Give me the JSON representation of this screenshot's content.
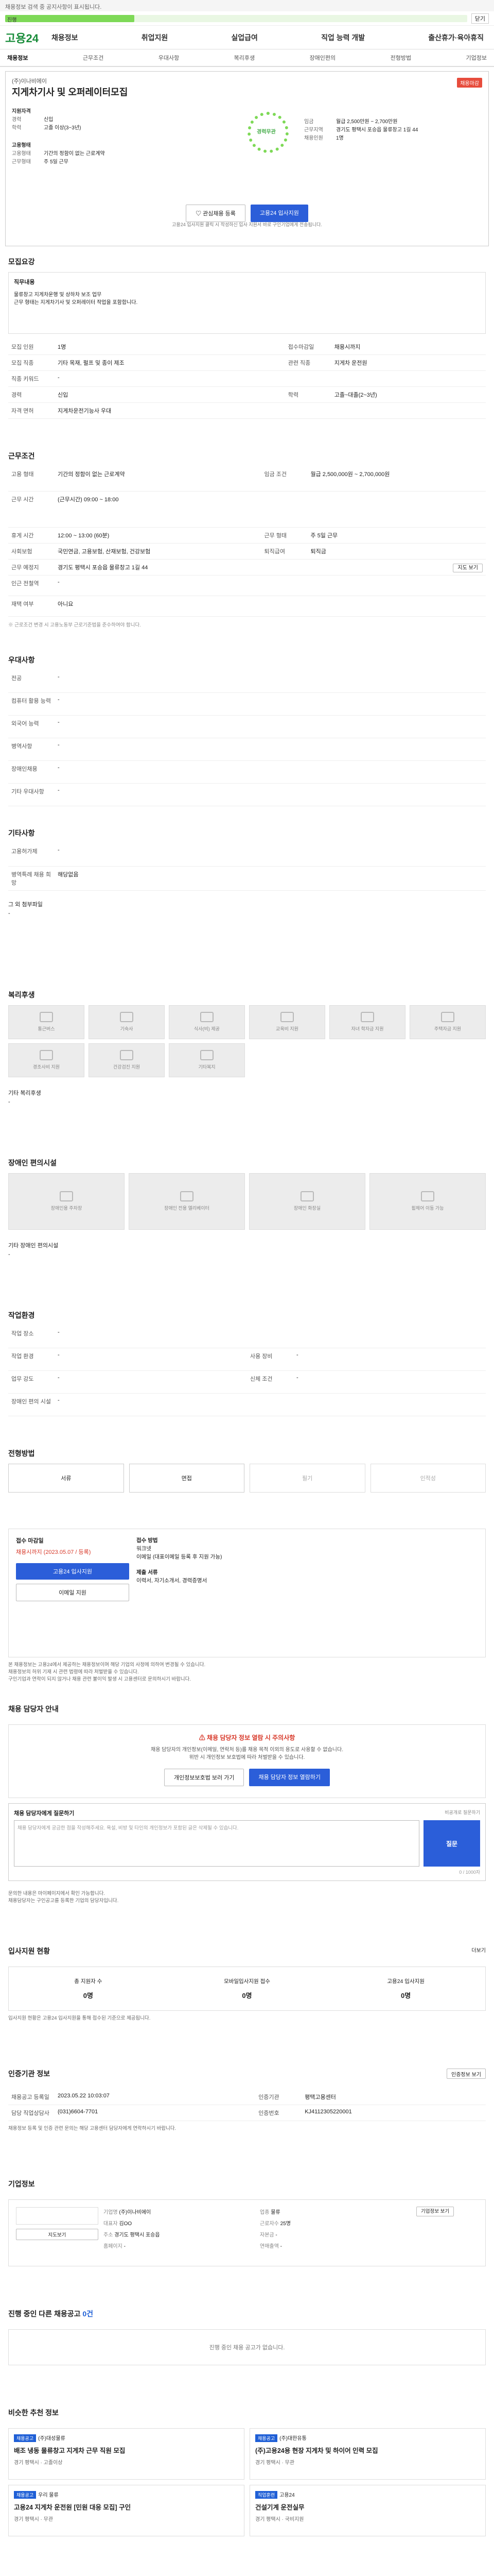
{
  "notice": "채용정보 검색 중 공지사항이 표시됩니다.",
  "progress": {
    "label": "진행",
    "fraction": 0.28,
    "button": "닫기"
  },
  "header": {
    "logo": "고용24",
    "gnb": [
      "채용정보",
      "취업지원",
      "실업급여",
      "직업 능력 개발",
      "출산휴가·육아휴직"
    ]
  },
  "subnav": [
    "채용정보",
    "근무조건",
    "우대사항",
    "복리후생",
    "장애인편의",
    "전형방법",
    "기업정보"
  ],
  "job": {
    "company": "(주)이나비에이",
    "title": "지게차기사 및 오퍼레이터모집",
    "tag": "채용마감",
    "rows": [
      {
        "k": "지원자격",
        "v": ""
      },
      {
        "k": "경력",
        "v": "신입"
      },
      {
        "k": "학력",
        "v": "고졸 이상(3~3년)"
      },
      {
        "k": "고용형태",
        "v": ""
      },
      {
        "k": "고용형태",
        "v": "기간의 정함이 없는 근로계약"
      },
      {
        "k": "근무형태",
        "v": "주 5일 근무"
      }
    ],
    "circle": "경력무관",
    "right": [
      {
        "k": "임금",
        "v": "월급 2,500만원 ~ 2,700만원"
      },
      {
        "k": "근무지역",
        "v": "경기도 평택시 포승읍 물류창고 1길 44"
      },
      {
        "k": "채용인원",
        "v": "1명"
      }
    ],
    "btn_scrap": "관심채용 등록",
    "btn_apply": "고용24 입사지원",
    "note": "고용24 입사지원 클릭 시 작성하신 입사 지원서 바로 구인기업에게 전송됩니다."
  },
  "recruit": {
    "title": "모집요강",
    "duty_label": "직무내용",
    "duty_lines": [
      "물류창고 지게차운행 및 상하차 보조 업무",
      "근무 형태는 지게차기사 및 오퍼레이터 작업을 포함합니다."
    ],
    "rows": [
      [
        "모집 인원",
        "1명",
        "접수마감일",
        "채용시까지"
      ],
      [
        "모집 직종",
        "기타 목재, 펄프 및 종이 제조",
        "관련 직종",
        "지게차 운전원"
      ],
      [
        "직종 키워드",
        "-",
        "",
        ""
      ],
      [
        "경력",
        "신입",
        "학력",
        "고졸~대졸(2~3년)"
      ],
      [
        "자격 면허",
        "지게차운전기능사 우대",
        "",
        ""
      ]
    ]
  },
  "work": {
    "title": "근무조건",
    "rows": [
      [
        "고용 형태",
        "기간의 정함이 없는 근로계약",
        "임금 조건",
        "월급 2,500,000원 ~ 2,700,000원"
      ],
      [
        "근무 시간",
        "(근무시간) 09:00 ~ 18:00",
        "",
        ""
      ],
      [
        "휴게 시간",
        "12:00 ~ 13:00 (60분)",
        "근무 형태",
        "주 5일 근무"
      ],
      [
        "사회보험",
        "국민연금, 고용보험, 산재보험, 건강보험",
        "퇴직급여",
        "퇴직금"
      ],
      [
        "근무 예정지",
        "경기도 평택시 포승읍 물류창고 1길 44",
        "",
        ""
      ],
      [
        "인근 전철역",
        "-",
        "",
        ""
      ],
      [
        "재택 여부",
        "아니요",
        "",
        ""
      ]
    ],
    "map_btn": "지도 보기",
    "note": "※ 근로조건 변경 시 고용노동부 근로기준법을 준수하여야 합니다."
  },
  "prefer": {
    "title": "우대사항",
    "rows": [
      [
        "전공",
        "-"
      ],
      [
        "컴퓨터 활용 능력",
        "-"
      ],
      [
        "외국어 능력",
        "-"
      ],
      [
        "병역사항",
        "-"
      ],
      [
        "장애인채용",
        "-"
      ],
      [
        "기타 우대사항",
        "-"
      ]
    ]
  },
  "other": {
    "title": "기타사항",
    "rows": [
      [
        "고용허가제",
        "-"
      ],
      [
        "병역특례 채용 희망",
        "해당없음"
      ]
    ],
    "attach_label": "그 외 첨부파일",
    "attach_value": "-"
  },
  "welfare": {
    "title": "복리후생",
    "items": [
      "통근버스",
      "기숙사",
      "식사(비) 제공",
      "교육비 지원",
      "자녀 학자금 지원",
      "주택자금 지원",
      "경조사비 지원",
      "건강검진 지원",
      "기타복지"
    ],
    "other_label": "기타 복리후생",
    "other_value": "-"
  },
  "disabled": {
    "title": "장애인 편의시설",
    "items": [
      "장애인용 주차장",
      "장애인 전용 엘리베이터",
      "장애인 화장실",
      "휠체어 이동 가능"
    ],
    "other_label": "기타 장애인 편의시설",
    "other_value": "-"
  },
  "env": {
    "title": "작업환경",
    "rows": [
      [
        "작업 장소",
        "-",
        "",
        ""
      ],
      [
        "작업 환경",
        "-",
        "사용 장비",
        "-"
      ],
      [
        "업무 강도",
        "-",
        "신체 조건",
        "-"
      ],
      [
        "장애인 편의 시설",
        "-",
        "",
        ""
      ]
    ]
  },
  "process": {
    "title": "전형방법",
    "steps": [
      "서류",
      "면접",
      "필기",
      "인적성"
    ]
  },
  "apply": {
    "title": "접수 마감일",
    "deadline": "채용시까지 (2023.05.07 / 등록)",
    "btn_apply": "고용24 입사지원",
    "btn_email": "이메일 지원",
    "method_label": "접수 방법",
    "methods": [
      "워크넷",
      "이메일 (대표이메일 등록 후 지원 가능)"
    ],
    "docs_label": "제출 서류",
    "docs": [
      "이력서, 자기소개서, 경력증명서"
    ]
  },
  "bullets": [
    "본 채용정보는 고용24에서 제공하는 채용정보이며 해당 기업의 사정에 의하여 변경될 수 있습니다.",
    "채용정보의 허위 기재 시 관련 법령에 따라 처벌받을 수 있습니다.",
    "구인기업과 연락이 되지 않거나 채용 관련 불이익 발생 시 고용센터로 문의하시기 바랍니다."
  ],
  "manager": {
    "title": "채용 담당자 안내",
    "alert": "채용 담당자 정보 열람 시 주의사항",
    "line1": "채용 담당자의 개인정보(이메일, 연락처 등)를 채용 목적 이외의 용도로 사용할 수 없습니다.",
    "line2": "위반 시 개인정보 보호법에 따라 처벌받을 수 있습니다.",
    "btn1": "개인정보보호법 보러 가기",
    "btn2": "채용 담당자 정보 열람하기",
    "qna_label": "채용 담당자에게 질문하기",
    "qna_hint": "비공개로 질문하기",
    "qna_placeholder": "채용 담당자에게 궁금한 점을 작성해주세요. 욕설, 비방 및 타인의 개인정보가 포함된 글은 삭제될 수 있습니다.",
    "qna_submit": "질문",
    "qna_count": "0 / 1000자",
    "notes": [
      "문의한 내용은 마이페이지에서 확인 가능합니다.",
      "채용담당자는 구인공고를 등록한 기업의 담당자입니다."
    ]
  },
  "stats": {
    "title": "입사지원 현황",
    "more": "더보기",
    "items": [
      {
        "label": "총 지원자 수",
        "value": "0명"
      },
      {
        "label": "모바일입사지원 접수",
        "value": "0명"
      },
      {
        "label": "고용24 입사지원",
        "value": "0명"
      }
    ],
    "note": "입사지원 현황은 고용24 입사지원을 통해 접수된 기준으로 제공됩니다."
  },
  "info": {
    "title": "인증기관 정보",
    "btn": "인증정보 보기",
    "rows": [
      [
        "채용공고 등록일",
        "2023.05.22 10:03:07",
        "인증기관",
        "평택고용센터"
      ],
      [
        "담당 직업상담사",
        "(031)6604-7701",
        "인증번호",
        "KJ4112305220001"
      ]
    ],
    "note": "채용정보 등록 및 인증 관련 문의는 해당 고용센터 담당자에게 연락하시기 바랍니다."
  },
  "company": {
    "title": "기업정보",
    "btn_map": "지도보기",
    "btn_more": "기업정보 보기",
    "rows": [
      [
        "기업명",
        "(주)이나비에이",
        "업종",
        "물류"
      ],
      [
        "대표자",
        "김OO",
        "근로자수",
        "25명"
      ],
      [
        "주소",
        "경기도 평택시 포승읍",
        "자본금",
        "-"
      ],
      [
        "홈페이지",
        "-",
        "연매출액",
        "-"
      ]
    ]
  },
  "ongoing": {
    "title": "진행 중인 다른 채용공고",
    "count": "0건",
    "empty": "진행 중인 채용 공고가 없습니다."
  },
  "similar": {
    "title": "비슷한 추천 정보",
    "items": [
      {
        "badge": "채용공고",
        "company": "(주)대성물류",
        "title": "배조 냉동 물류창고 지게차 근무 직원 모집",
        "f1": "경기 평택시",
        "f2": "고졸이상"
      },
      {
        "badge": "채용공고",
        "company": "(주)대한유통",
        "title": "(주)고용24용 현장 지게차 및 하이어 인력 모집",
        "f1": "경기 평택시",
        "f2": "무관"
      },
      {
        "badge": "채용공고",
        "company": "우리 물류",
        "title": "고용24 지게차 운전원 [민원 대응 모집] 구인",
        "f1": "경기 평택시",
        "f2": "무관"
      },
      {
        "badge": "직업훈련",
        "company": "고용24",
        "title": "건설기계 운전실무",
        "f1": "경기 평택시",
        "f2": "국비지원"
      }
    ]
  }
}
